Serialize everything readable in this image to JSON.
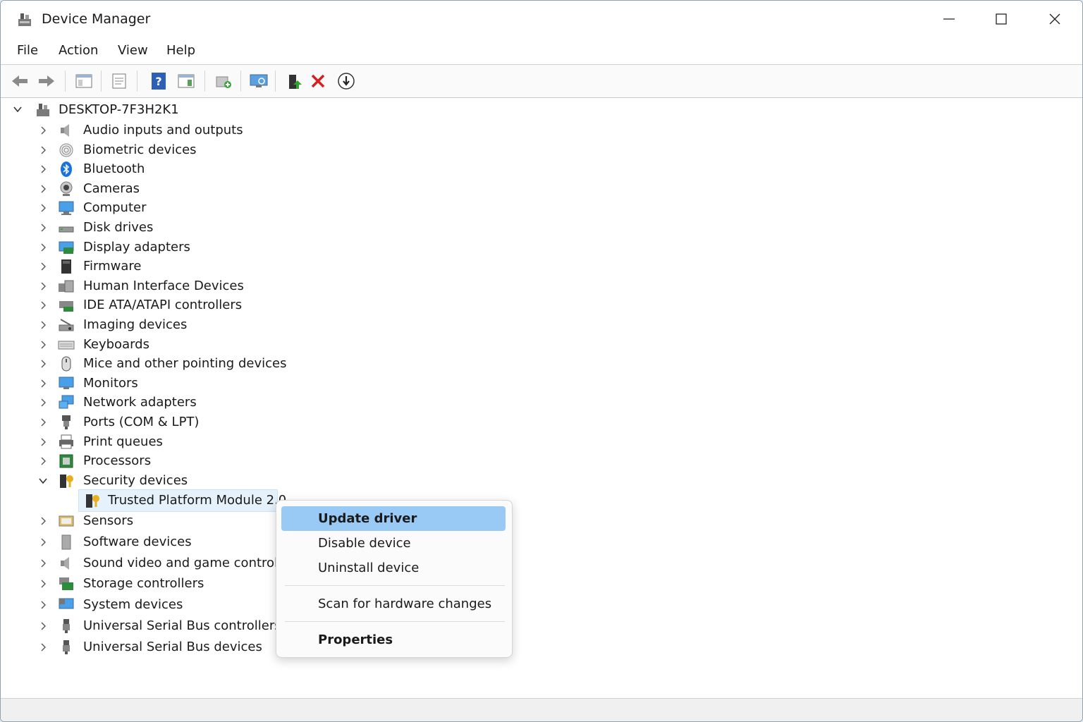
{
  "window": {
    "title": "Device Manager"
  },
  "menu": [
    "File",
    "Action",
    "View",
    "Help"
  ],
  "toolbar": [
    "back-icon",
    "forward-icon",
    "show-hide-console-tree-icon",
    "properties-icon",
    "help-icon",
    "action-pane-icon",
    "add-legacy-hardware-icon",
    "scan-hardware-icon",
    "update-driver-icon",
    "uninstall-icon",
    "disable-device-icon"
  ],
  "tree": {
    "root": "DESKTOP-7F3H2K1",
    "categories": [
      {
        "label": "Audio inputs and outputs",
        "icon": "speaker-icon"
      },
      {
        "label": "Biometric devices",
        "icon": "fingerprint-icon"
      },
      {
        "label": "Bluetooth",
        "icon": "bluetooth-icon"
      },
      {
        "label": "Cameras",
        "icon": "webcam-icon"
      },
      {
        "label": "Computer",
        "icon": "computer-icon"
      },
      {
        "label": "Disk drives",
        "icon": "disk-drive-icon"
      },
      {
        "label": "Display adapters",
        "icon": "display-adapter-icon"
      },
      {
        "label": "Firmware",
        "icon": "firmware-icon"
      },
      {
        "label": "Human Interface Devices",
        "icon": "hid-icon"
      },
      {
        "label": "IDE ATA/ATAPI controllers",
        "icon": "ide-controller-icon"
      },
      {
        "label": "Imaging devices",
        "icon": "scanner-icon"
      },
      {
        "label": "Keyboards",
        "icon": "keyboard-icon"
      },
      {
        "label": "Mice and other pointing devices",
        "icon": "mouse-icon"
      },
      {
        "label": "Monitors",
        "icon": "monitor-icon"
      },
      {
        "label": "Network adapters",
        "icon": "network-icon"
      },
      {
        "label": "Ports (COM & LPT)",
        "icon": "port-icon"
      },
      {
        "label": "Print queues",
        "icon": "printer-icon"
      },
      {
        "label": "Processors",
        "icon": "processor-icon"
      },
      {
        "label": "Security devices",
        "icon": "security-device-icon",
        "expanded": true
      },
      {
        "label": "Sensors",
        "icon": "sensor-icon"
      },
      {
        "label": "Software devices",
        "icon": "software-device-icon"
      },
      {
        "label": "Sound video and game controllers",
        "icon": "speaker-icon"
      },
      {
        "label": "Storage controllers",
        "icon": "storage-controller-icon"
      },
      {
        "label": "System devices",
        "icon": "system-device-icon"
      },
      {
        "label": "Universal Serial Bus controllers",
        "icon": "usb-icon"
      },
      {
        "label": "Universal Serial Bus devices",
        "icon": "usb-icon"
      }
    ],
    "child": "Trusted Platform Module 2.0"
  },
  "context_menu": {
    "update": "Update driver",
    "disable": "Disable device",
    "uninstall": "Uninstall device",
    "scan": "Scan for hardware changes",
    "properties": "Properties"
  }
}
